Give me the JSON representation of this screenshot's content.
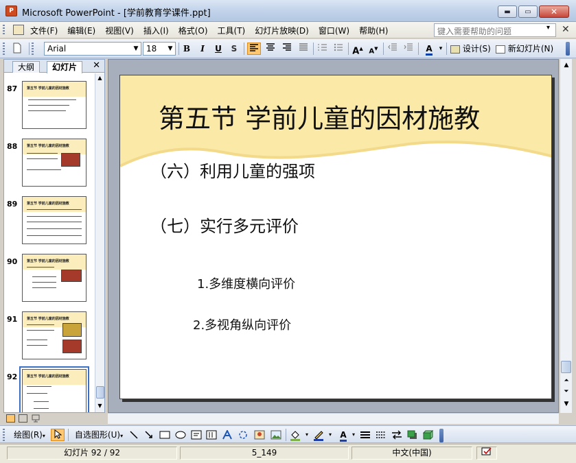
{
  "window": {
    "title": "Microsoft PowerPoint - [学前教育学课件.ppt]",
    "app_icon_label": "P",
    "minimize_glyph": "▬",
    "maximize_glyph": "▭",
    "close_glyph": "✕"
  },
  "menu": {
    "items": [
      "文件(F)",
      "编辑(E)",
      "视图(V)",
      "插入(I)",
      "格式(O)",
      "工具(T)",
      "幻灯片放映(D)",
      "窗口(W)",
      "帮助(H)"
    ],
    "help_placeholder": "键入需要帮助的问题",
    "help_arrow": "▾",
    "close_glyph": "✕"
  },
  "format_toolbar": {
    "font": "Arial",
    "size": "18",
    "bold": "B",
    "italic": "I",
    "underline": "U",
    "shadow": "S",
    "design_label": "设计(S)",
    "new_slide_label": "新幻灯片(N)"
  },
  "left_pane": {
    "tab_outline": "大纲",
    "tab_slides": "幻灯片",
    "close_glyph": "✕",
    "thumbnails": [
      {
        "num": "87",
        "title": "第五节 学前儿童的因材施教"
      },
      {
        "num": "88",
        "title": "第五节 学前儿童的因材施教"
      },
      {
        "num": "89",
        "title": "第五节 学前儿童的因材施教"
      },
      {
        "num": "90",
        "title": "第五节 学前儿童的因材施教"
      },
      {
        "num": "91",
        "title": "第五节 学前儿童的因材施教"
      },
      {
        "num": "92",
        "title": "第五节 学前儿童的因材施教"
      }
    ]
  },
  "slide": {
    "title": "第五节  学前儿童的因材施教",
    "line1": "（六）利用儿童的强项",
    "line2": "（七）实行多元评价",
    "line3": "1.多维度横向评价",
    "line4": "2.多视角纵向评价"
  },
  "draw_toolbar": {
    "draw_label": "绘图(R)",
    "autoshapes_label": "自选图形(U)"
  },
  "status": {
    "slide_count": "幻灯片 92 / 92",
    "design": "5_149",
    "language": "中文(中国)"
  }
}
